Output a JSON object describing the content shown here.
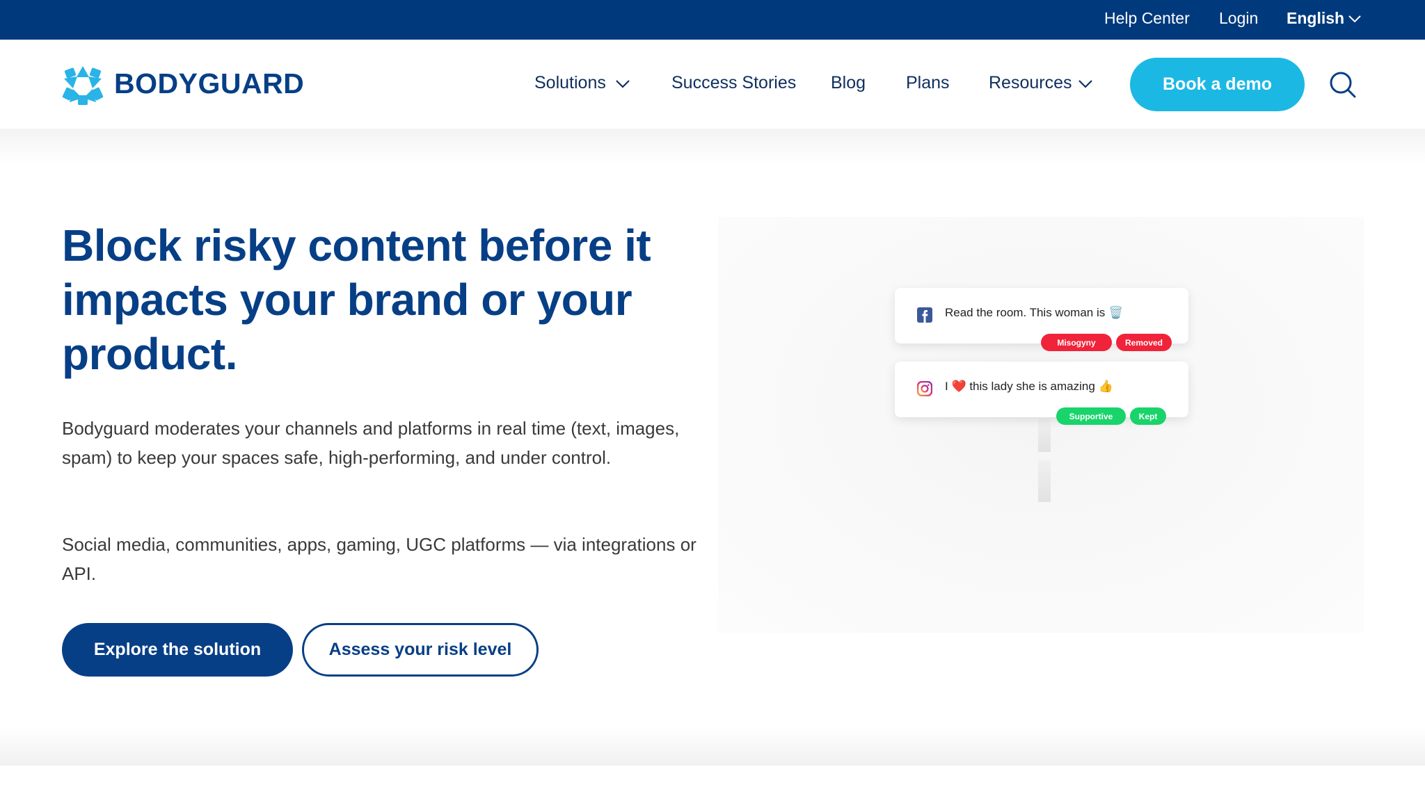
{
  "topbar": {
    "help_center": "Help Center",
    "login": "Login",
    "language": "English"
  },
  "nav": {
    "logo_text": "BODYGUARD",
    "solutions": "Solutions",
    "success_stories": "Success Stories",
    "blog": "Blog",
    "plans": "Plans",
    "resources": "Resources",
    "book_demo": "Book a demo"
  },
  "hero": {
    "title": "Block risky content before it impacts your brand or your product.",
    "paragraph1": "Bodyguard moderates your channels and platforms in real time (text, images, spam) to keep your spaces safe, high-performing, and under control.",
    "paragraph2": "Social media, communities, apps, gaming, UGC platforms — via integrations or API.",
    "primary_cta": "Explore the solution",
    "secondary_cta": "Assess your risk level"
  },
  "illustration": {
    "comment1": {
      "source_icon": "facebook-icon",
      "text": "Read the room. This woman is 🗑️",
      "tags": [
        "Misogyny",
        "Removed"
      ]
    },
    "comment2": {
      "source_icon": "instagram-icon",
      "text": "I ❤️ this lady she is amazing 👍",
      "tags": [
        "Supportive",
        "Kept"
      ]
    }
  },
  "colors": {
    "brand_navy": "#073f86",
    "topbar_bg": "#003a7d",
    "accent_cyan": "#1cb8e4",
    "tag_red": "#f0233a",
    "tag_green": "#18d46b"
  }
}
